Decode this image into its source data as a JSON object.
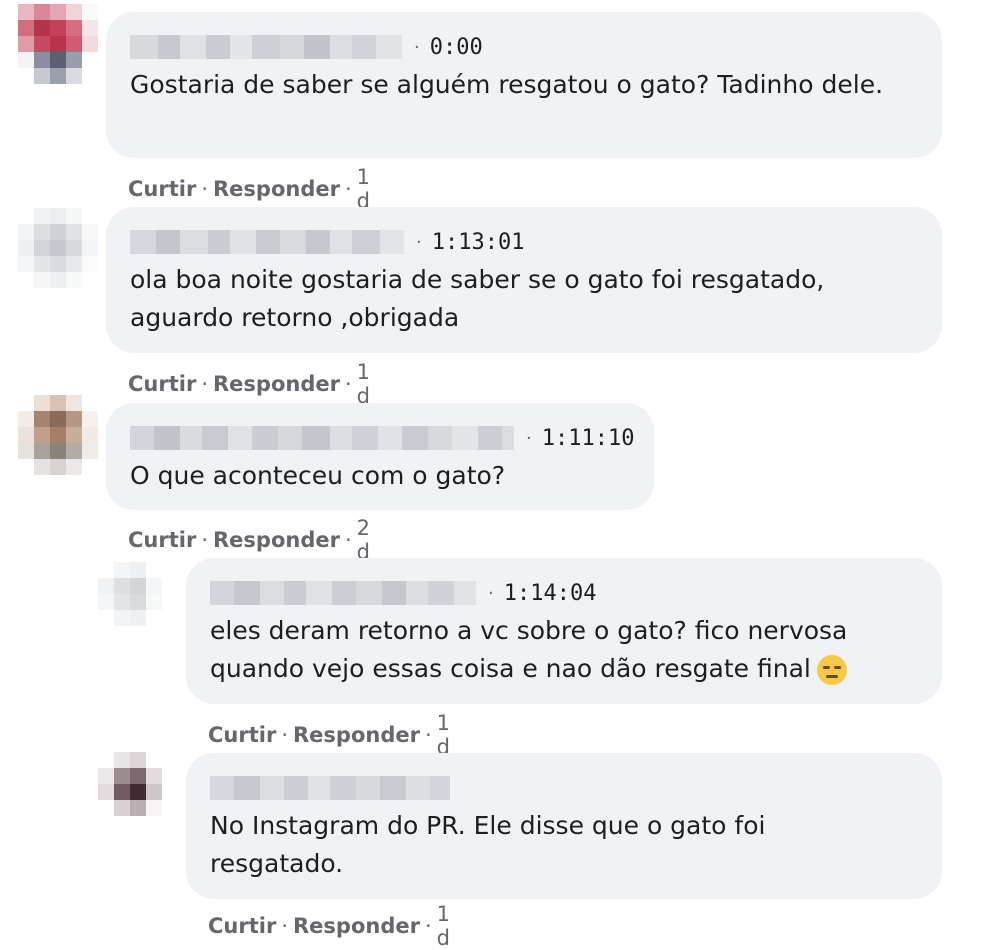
{
  "comments": [
    {
      "timestamp": "0:00",
      "text": "Gostaria de saber se alguém resgatou o gato? Tadinho dele.",
      "like_label": "Curtir",
      "reply_label": "Responder",
      "age": "1 d"
    },
    {
      "timestamp": "1:13:01",
      "text": "ola boa noite gostaria de saber se o gato foi resgatado, aguardo retorno ,obrigada",
      "like_label": "Curtir",
      "reply_label": "Responder",
      "age": "1 d"
    },
    {
      "timestamp": "1:11:10",
      "text": "O que aconteceu com o gato?",
      "like_label": "Curtir",
      "reply_label": "Responder",
      "age": "2 d"
    },
    {
      "timestamp": "1:14:04",
      "text": "eles deram retorno a vc sobre o gato? fico nervosa quando vejo essas coisa e nao dão resgate final",
      "emoji": "downcast-face-emoji",
      "like_label": "Curtir",
      "reply_label": "Responder",
      "age": "1 d"
    },
    {
      "timestamp": "",
      "text": "No Instagram do PR. Ele disse que o gato foi resgatado.",
      "like_label": "Curtir",
      "reply_label": "Responder",
      "age": "1 d"
    }
  ],
  "separator": "·",
  "colors": {
    "bubble": "#f0f2f5",
    "meta_text": "#65676b",
    "body_text": "#1c1e21"
  }
}
